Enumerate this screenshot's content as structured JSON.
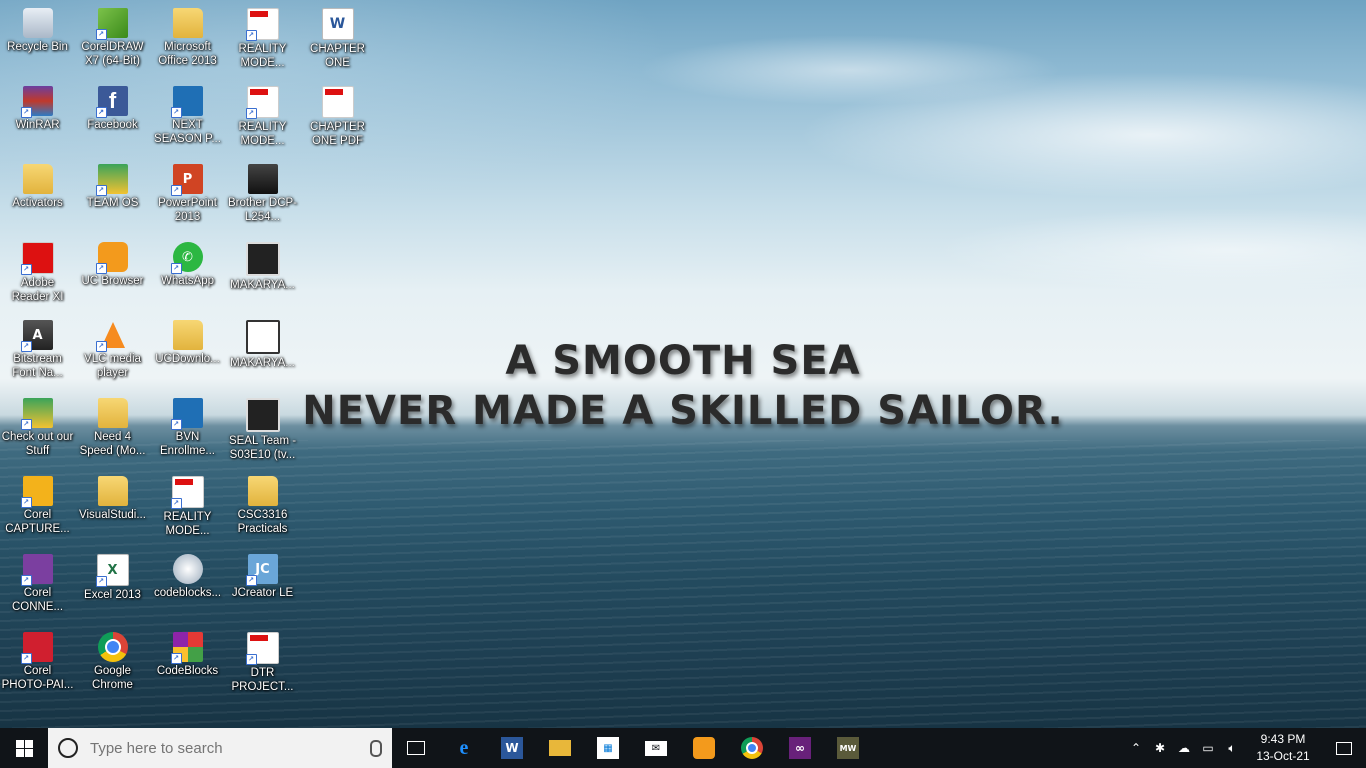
{
  "wallpaper": {
    "quote_line1": "A SMOOTH SEA",
    "quote_line2": "NEVER MADE A SKILLED SAILOR."
  },
  "desktop_icons": [
    {
      "label": "Recycle Bin",
      "icon": "recycle-bin-icon"
    },
    {
      "label": "CorelDRAW X7 (64-Bit)",
      "icon": "coreldraw-icon"
    },
    {
      "label": "Microsoft Office 2013",
      "icon": "folder-icon"
    },
    {
      "label": "REALITY MODE...",
      "icon": "pdf-icon"
    },
    {
      "label": "CHAPTER ONE",
      "icon": "word-document-icon"
    },
    {
      "label": "WinRAR",
      "icon": "winrar-icon"
    },
    {
      "label": "Facebook",
      "icon": "facebook-icon"
    },
    {
      "label": "NEXT SEASON P...",
      "icon": "app-icon"
    },
    {
      "label": "REALITY MODE...",
      "icon": "pdf-icon"
    },
    {
      "label": "CHAPTER ONE PDF",
      "icon": "pdf-icon"
    },
    {
      "label": "Activators",
      "icon": "folder-icon"
    },
    {
      "label": "TEAM OS",
      "icon": "teamos-icon"
    },
    {
      "label": "PowerPoint 2013",
      "icon": "powerpoint-icon"
    },
    {
      "label": "Brother DCP-L254...",
      "icon": "printer-icon"
    },
    {
      "label": "Adobe Reader XI",
      "icon": "adobe-reader-icon"
    },
    {
      "label": "UC Browser",
      "icon": "uc-browser-icon"
    },
    {
      "label": "WhatsApp",
      "icon": "whatsapp-icon"
    },
    {
      "label": "MAKARYA...",
      "icon": "video-icon"
    },
    {
      "label": "Bitstream Font Na...",
      "icon": "bitstream-icon"
    },
    {
      "label": "VLC media player",
      "icon": "vlc-icon"
    },
    {
      "label": "UCDownlo...",
      "icon": "folder-icon"
    },
    {
      "label": "MAKARYA...",
      "icon": "film-icon"
    },
    {
      "label": "Check out our Stuff",
      "icon": "teamos-icon"
    },
    {
      "label": "Need 4 Speed (Mo...",
      "icon": "folder-icon"
    },
    {
      "label": "BVN Enrollme...",
      "icon": "bvn-icon"
    },
    {
      "label": "SEAL Team - S03E10 (tv...",
      "icon": "video-icon"
    },
    {
      "label": "Corel CAPTURE...",
      "icon": "corel-capture-icon"
    },
    {
      "label": "VisualStudi...",
      "icon": "visual-studio-icon"
    },
    {
      "label": "REALITY MODE...",
      "icon": "pdf-icon"
    },
    {
      "label": "CSC3316 Practicals",
      "icon": "folder-icon"
    },
    {
      "label": "Corel CONNE...",
      "icon": "corel-connect-icon"
    },
    {
      "label": "Excel 2013",
      "icon": "excel-icon"
    },
    {
      "label": "codeblocks...",
      "icon": "codeblocks-setup-icon"
    },
    {
      "label": "JCreator LE",
      "icon": "jcreator-icon"
    },
    {
      "label": "Corel PHOTO-PAI...",
      "icon": "corel-photopaint-icon"
    },
    {
      "label": "Google Chrome",
      "icon": "chrome-icon"
    },
    {
      "label": "CodeBlocks",
      "icon": "codeblocks-icon"
    },
    {
      "label": "DTR PROJECT...",
      "icon": "pdf-icon"
    }
  ],
  "taskbar": {
    "search_placeholder": "Type here to search",
    "pinned": [
      "edge-icon",
      "word-icon",
      "file-explorer-icon",
      "store-icon",
      "mail-icon",
      "uc-browser-icon",
      "chrome-icon",
      "visual-studio-icon",
      "mw-game-icon"
    ],
    "time": "9:43 PM",
    "date": "13-Oct-21"
  }
}
